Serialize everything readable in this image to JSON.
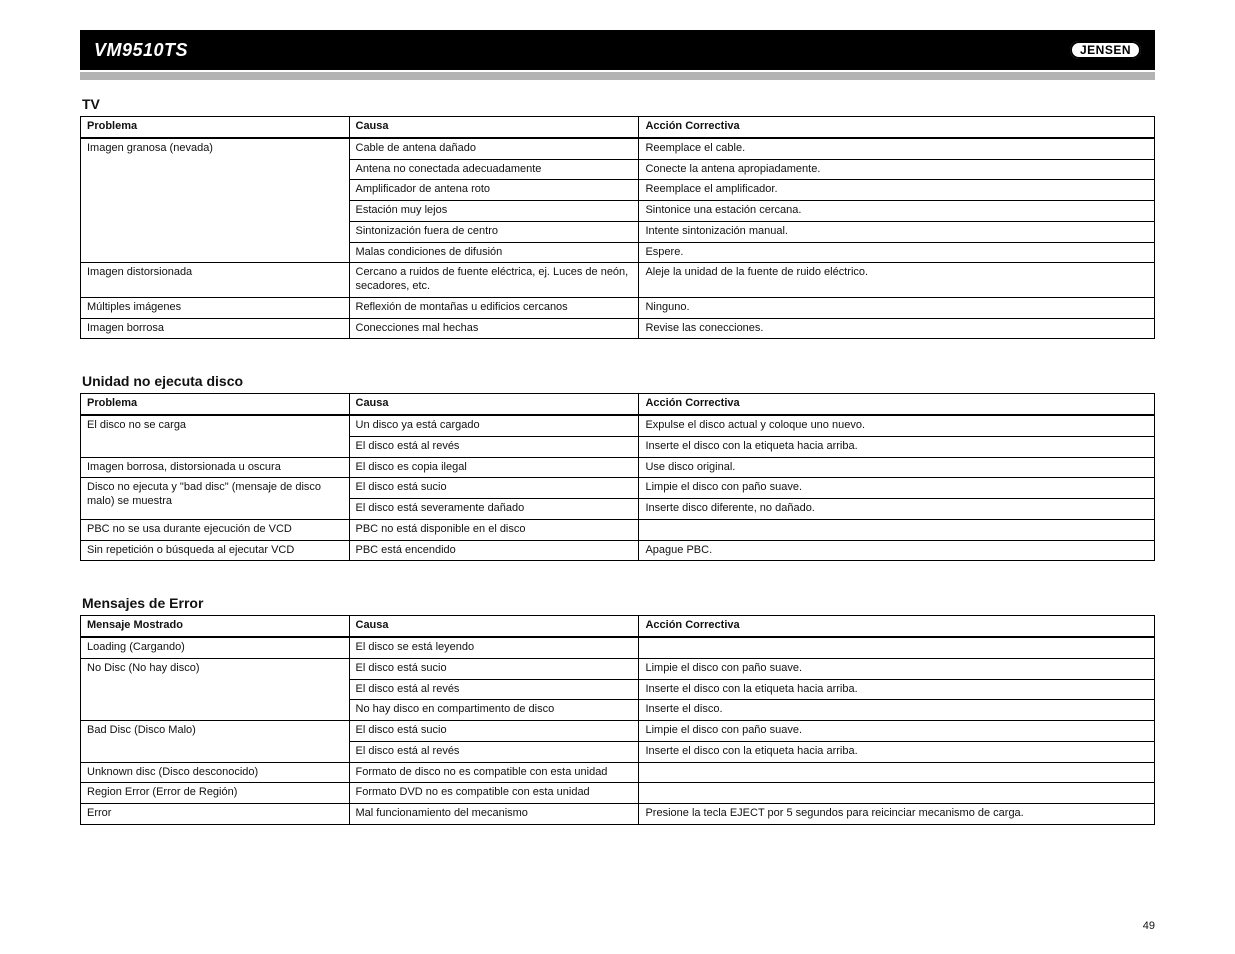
{
  "bar_title": "VM9510TS",
  "logo_text": "JENSEN",
  "page_number": "49",
  "sections": {
    "tv": {
      "heading": "TV",
      "headers": [
        "Problema",
        "Causa",
        "Acción Correctiva"
      ],
      "rows": [
        [
          "Imagen granosa (nevada)",
          "Cable de antena dañado",
          "Reemplace el cable."
        ],
        [
          "",
          "Antena no conectada adecuadamente",
          "Conecte la antena apropiadamente."
        ],
        [
          "",
          "Amplificador de antena roto",
          "Reemplace el amplificador."
        ],
        [
          "",
          "Estación muy lejos",
          "Sintonice una estación cercana."
        ],
        [
          "",
          "Sintonización fuera de centro",
          "Intente sintonización manual."
        ],
        [
          "",
          "Malas condiciones de difusión",
          "Espere."
        ],
        [
          "Imagen distorsionada",
          "Cercano a ruidos de fuente eléctrica, ej. Luces de neón, secadores, etc.",
          "Aleje la unidad de la fuente de ruido eléctrico."
        ],
        [
          "Múltiples imágenes",
          "Reflexión de montañas u edificios cercanos",
          "Ninguno."
        ],
        [
          "Imagen borrosa",
          "Conecciones mal hechas",
          "Revise las conecciones."
        ]
      ]
    },
    "cd": {
      "heading": "Unidad no ejecuta disco",
      "headers": [
        "Problema",
        "Causa",
        "Acción Correctiva"
      ],
      "rows": [
        [
          "El disco no se carga",
          "Un disco ya está cargado",
          "Expulse el disco actual y coloque uno nuevo."
        ],
        [
          "",
          "El disco está al revés",
          "Inserte el disco con la etiqueta hacia arriba."
        ],
        [
          "Imagen borrosa, distorsionada u oscura",
          "El disco es copia ilegal",
          "Use disco original."
        ],
        [
          "Disco no ejecuta y \"bad disc\" (mensaje de disco malo) se muestra",
          "El disco está sucio",
          "Limpie el disco con paño suave."
        ],
        [
          "",
          "El disco está severamente dañado",
          "Inserte disco diferente, no dañado."
        ],
        [
          "PBC no se usa durante ejecución de VCD",
          "PBC no está disponible en el disco",
          ""
        ],
        [
          "Sin repetición o búsqueda al ejecutar VCD",
          "PBC está encendido",
          "Apague PBC."
        ]
      ]
    },
    "codes": {
      "heading": "Mensajes de Error",
      "headers": [
        "Mensaje Mostrado",
        "Causa",
        "Acción Correctiva"
      ],
      "rows": [
        [
          "Loading (Cargando)",
          "El disco se está leyendo",
          ""
        ],
        [
          "No Disc (No hay disco)",
          "El disco está sucio",
          "Limpie el disco con paño suave."
        ],
        [
          "",
          "El disco está al revés",
          "Inserte el disco con la etiqueta hacia arriba."
        ],
        [
          "",
          "No hay disco en compartimento de disco",
          "Inserte el disco."
        ],
        [
          "Bad Disc (Disco Malo)",
          "El disco está sucio",
          "Limpie el disco con paño suave."
        ],
        [
          "",
          "El disco está al revés",
          "Inserte el disco con la etiqueta hacia arriba."
        ],
        [
          "Unknown disc (Disco desconocido)",
          "Formato de disco no es compatible con esta unidad",
          ""
        ],
        [
          "Region Error (Error de Región)",
          "Formato DVD no es compatible con esta unidad",
          ""
        ],
        [
          "Error",
          "Mal funcionamiento del mecanismo",
          "Presione la tecla EJECT por 5 segundos para reicinciar mecanismo de carga."
        ]
      ]
    }
  }
}
